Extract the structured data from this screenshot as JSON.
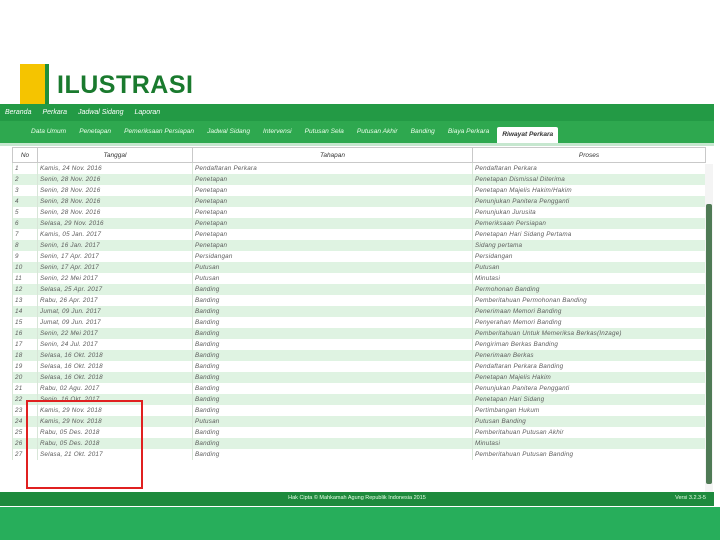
{
  "slide": {
    "title": "ILUSTRASI"
  },
  "topnav": [
    "Beranda",
    "Perkara",
    "Jadwal Sidang",
    "Laporan"
  ],
  "tabs": [
    {
      "label": "Data Umum",
      "active": false
    },
    {
      "label": "Penetapan",
      "active": false
    },
    {
      "label": "Pemeriksaan Persiapan",
      "active": false
    },
    {
      "label": "Jadwal Sidang",
      "active": false
    },
    {
      "label": "Intervensi",
      "active": false
    },
    {
      "label": "Putusan Sela",
      "active": false
    },
    {
      "label": "Putusan Akhir",
      "active": false
    },
    {
      "label": "Banding",
      "active": false
    },
    {
      "label": "Biaya Perkara",
      "active": false
    },
    {
      "label": "Riwayat Perkara",
      "active": true
    }
  ],
  "table": {
    "headers": [
      "No",
      "Tanggal",
      "Tahapan",
      "Proses"
    ],
    "rows": [
      [
        "1",
        "Kamis, 24 Nov. 2016",
        "Pendaftaran Perkara",
        "Pendaftaran Perkara"
      ],
      [
        "2",
        "Senin, 28 Nov. 2016",
        "Penetapan",
        "Penetapan Dismissal Diterima"
      ],
      [
        "3",
        "Senin, 28 Nov. 2016",
        "Penetapan",
        "Penetapan Majelis Hakim/Hakim"
      ],
      [
        "4",
        "Senin, 28 Nov. 2016",
        "Penetapan",
        "Penunjukan Panitera Pengganti"
      ],
      [
        "5",
        "Senin, 28 Nov. 2016",
        "Penetapan",
        "Penunjukan Jurusita"
      ],
      [
        "6",
        "Selasa, 29 Nov. 2016",
        "Penetapan",
        "Pemeriksaan Persiapan"
      ],
      [
        "7",
        "Kamis, 05 Jan. 2017",
        "Penetapan",
        "Penetapan Hari Sidang Pertama"
      ],
      [
        "8",
        "Senin, 16 Jan. 2017",
        "Penetapan",
        "Sidang pertama"
      ],
      [
        "9",
        "Senin, 17 Apr. 2017",
        "Persidangan",
        "Persidangan"
      ],
      [
        "10",
        "Senin, 17 Apr. 2017",
        "Putusan",
        "Putusan"
      ],
      [
        "11",
        "Senin, 22 Mei 2017",
        "Putusan",
        "Minutasi"
      ],
      [
        "12",
        "Selasa, 25 Apr. 2017",
        "Banding",
        "Permohonan Banding"
      ],
      [
        "13",
        "Rabu, 26 Apr. 2017",
        "Banding",
        "Pemberitahuan Permohonan Banding"
      ],
      [
        "14",
        "Jumat, 09 Jun. 2017",
        "Banding",
        "Penerimaan Memori Banding"
      ],
      [
        "15",
        "Jumat, 09 Jun. 2017",
        "Banding",
        "Penyerahan Memori Banding"
      ],
      [
        "16",
        "Senin, 22 Mei 2017",
        "Banding",
        "Pemberitahuan Untuk Memeriksa Berkas(Inzage)"
      ],
      [
        "17",
        "Senin, 24 Jul. 2017",
        "Banding",
        "Pengiriman Berkas Banding"
      ],
      [
        "18",
        "Selasa, 16 Okt. 2018",
        "Banding",
        "Penerimaan Berkas"
      ],
      [
        "19",
        "Selasa, 16 Okt. 2018",
        "Banding",
        "Pendaftaran Perkara Banding"
      ],
      [
        "20",
        "Selasa, 16 Okt. 2018",
        "Banding",
        "Penetapan Majelis Hakim"
      ],
      [
        "21",
        "Rabu, 02 Agu. 2017",
        "Banding",
        "Penunjukan Panitera Pengganti"
      ],
      [
        "22",
        "Senin, 16 Okt. 2017",
        "Banding",
        "Penetapan Hari Sidang"
      ],
      [
        "23",
        "Kamis, 29 Nov. 2018",
        "Banding",
        "Pertimbangan Hukum"
      ],
      [
        "24",
        "Kamis, 29 Nov. 2018",
        "Putusan",
        "Putusan Banding"
      ],
      [
        "25",
        "Rabu, 05 Des. 2018",
        "Banding",
        "Pemberitahuan Putusan Akhir"
      ],
      [
        "26",
        "Rabu, 05 Des. 2018",
        "Banding",
        "Minutasi"
      ],
      [
        "27",
        "Selasa, 21 Okt. 2017",
        "Banding",
        "Pemberitahuan Putusan Banding"
      ]
    ]
  },
  "footer": {
    "copyright": "Hak Cipta © Mahkamah Agung Republik Indonesia 2015",
    "version": "Versi 3.2.3-5"
  },
  "colors": {
    "brand_green": "#239a45",
    "accent_yellow": "#f5c400",
    "highlight_red": "#e02020",
    "row_alt": "#dff3e2"
  }
}
